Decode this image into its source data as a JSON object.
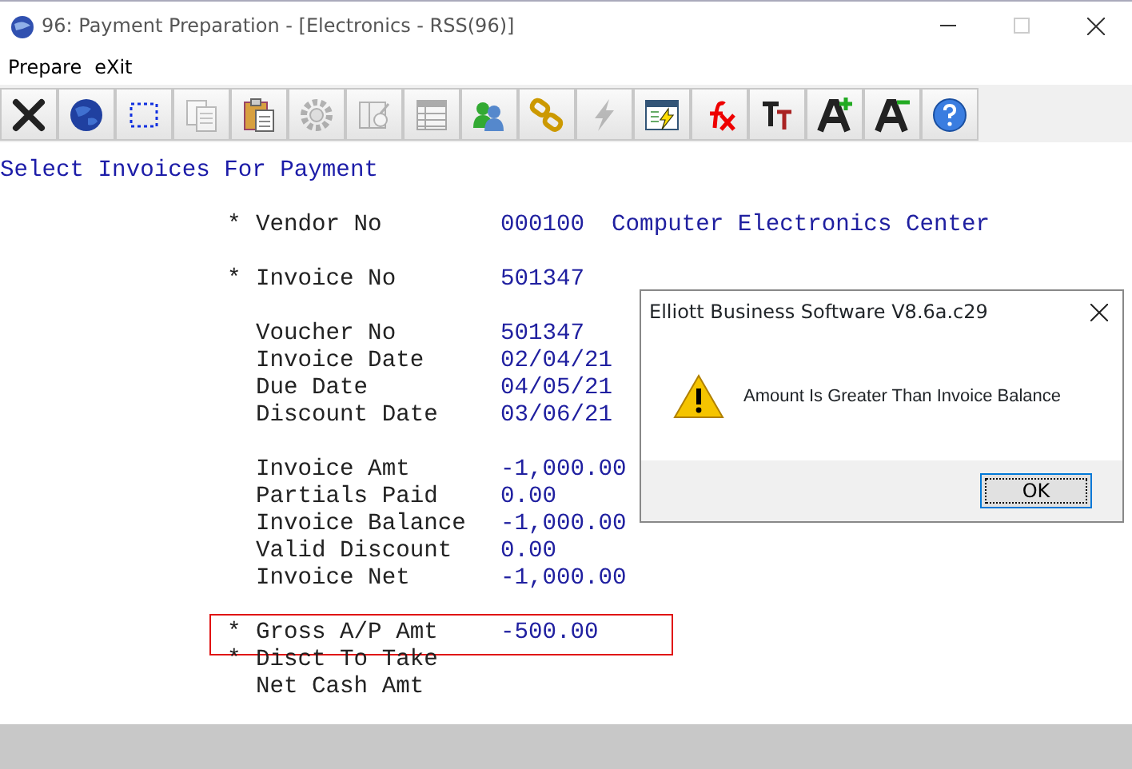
{
  "window": {
    "title": "96: Payment Preparation - [Electronics - RSS(96)]",
    "maximize_disabled": true
  },
  "menu": [
    {
      "label": "Prepare"
    },
    {
      "label": "eXit"
    }
  ],
  "toolbar": [
    {
      "kind": "close",
      "disabled": false
    },
    {
      "kind": "globe",
      "disabled": false
    },
    {
      "kind": "select",
      "disabled": false
    },
    {
      "kind": "copy",
      "disabled": true
    },
    {
      "kind": "paste",
      "disabled": false
    },
    {
      "kind": "gear",
      "disabled": true
    },
    {
      "kind": "form",
      "disabled": true
    },
    {
      "kind": "table",
      "disabled": true
    },
    {
      "kind": "users",
      "disabled": false
    },
    {
      "kind": "link",
      "disabled": false
    },
    {
      "kind": "bolt",
      "disabled": true
    },
    {
      "kind": "report",
      "disabled": false
    },
    {
      "kind": "fx",
      "disabled": false
    },
    {
      "kind": "textsize",
      "disabled": false
    },
    {
      "kind": "fontup",
      "disabled": false
    },
    {
      "kind": "fontdown",
      "disabled": false
    },
    {
      "kind": "help",
      "disabled": false
    }
  ],
  "screen_title": "Select Invoices For Payment",
  "groups": [
    [
      {
        "marker": "*",
        "label": "Vendor No",
        "value": "000100",
        "extra": "Computer Electronics Center",
        "highlighted": false
      }
    ],
    [
      {
        "marker": "*",
        "label": "Invoice No",
        "value": "501347",
        "highlighted": false
      }
    ],
    [
      {
        "label": "Voucher No",
        "value": "501347",
        "highlighted": false
      },
      {
        "label": "Invoice Date",
        "value": "02/04/21",
        "highlighted": false
      },
      {
        "label": "Due Date",
        "value": "04/05/21",
        "highlighted": false
      },
      {
        "label": "Discount Date",
        "value": "03/06/21",
        "highlighted": false
      }
    ],
    [
      {
        "label": "Invoice Amt",
        "value": "-1,000.00",
        "highlighted": false
      },
      {
        "label": "Partials Paid",
        "value": "0.00",
        "highlighted": false
      },
      {
        "label": "Invoice Balance",
        "value": "-1,000.00",
        "highlighted": false
      },
      {
        "label": "Valid Discount",
        "value": "0.00",
        "highlighted": false
      },
      {
        "label": "Invoice Net",
        "value": "-1,000.00",
        "highlighted": false
      }
    ],
    [
      {
        "marker": "*",
        "label": "Gross A/P Amt",
        "value": "-500.00",
        "highlighted": true
      },
      {
        "marker": "*",
        "label": "Disct To Take",
        "highlighted": false
      },
      {
        "label": "Net Cash Amt",
        "highlighted": false
      }
    ]
  ],
  "dialog": {
    "title": "Elliott Business Software V8.6a.c29",
    "message": "Amount Is Greater Than Invoice Balance",
    "button": "OK"
  }
}
